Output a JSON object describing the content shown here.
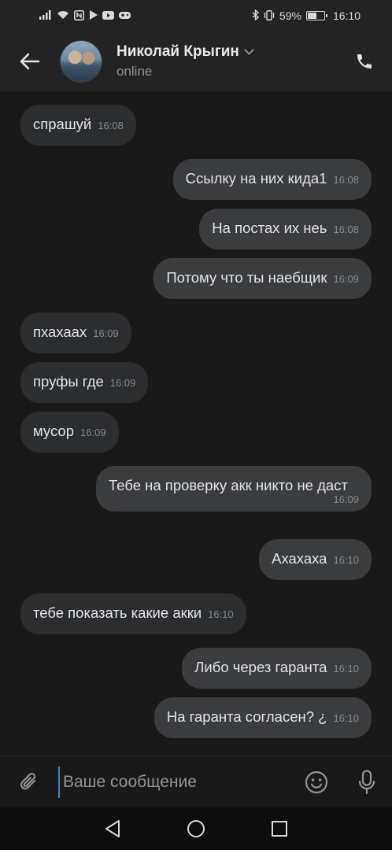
{
  "status_bar": {
    "bluetooth_icon": "bluetooth-icon",
    "battery_percent": "59%",
    "battery_level": 0.59,
    "time": "16:10"
  },
  "header": {
    "contact_name": "Николай Крыгин",
    "contact_status": "online"
  },
  "messages": [
    {
      "direction": "in",
      "text": "спрашуй",
      "time": "16:08"
    },
    {
      "direction": "out",
      "text": "Ссылку на них кида1",
      "time": "16:08"
    },
    {
      "direction": "out",
      "text": "На постах их неь",
      "time": "16:08"
    },
    {
      "direction": "out",
      "text": "Потому что ты наебщик",
      "time": "16:09"
    },
    {
      "direction": "in",
      "text": "пхахаах",
      "time": "16:09"
    },
    {
      "direction": "in",
      "text": "пруфы где",
      "time": "16:09"
    },
    {
      "direction": "in",
      "text": "мусор",
      "time": "16:09"
    },
    {
      "direction": "out",
      "text": "Тебе на проверку акк никто не даст",
      "time": "16:09"
    },
    {
      "direction": "out",
      "text": "Ахахаха",
      "time": "16:10"
    },
    {
      "direction": "in",
      "text": "тебе показать какие акки",
      "time": "16:10"
    },
    {
      "direction": "out",
      "text": "Либо через гаранта",
      "time": "16:10"
    },
    {
      "direction": "out",
      "text": "На гаранта согласен? ¿",
      "time": "16:10"
    }
  ],
  "composer": {
    "placeholder": "Ваше сообщение"
  },
  "colors": {
    "background": "#19191a",
    "incoming_bubble": "#2c2d2e",
    "outgoing_bubble": "#3b3c3e",
    "accent": "#5181b8"
  }
}
